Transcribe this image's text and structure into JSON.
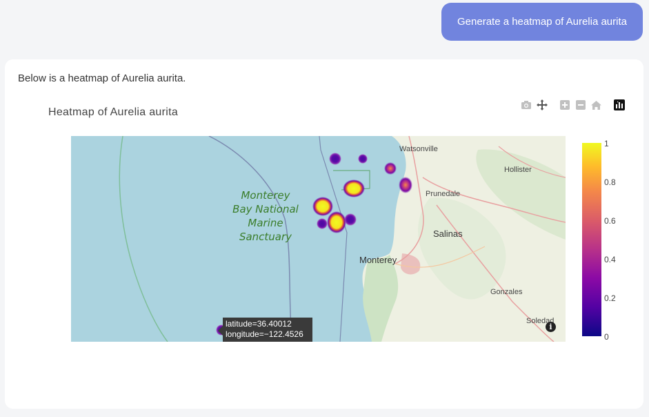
{
  "user_message": "Generate a heatmap of Aurelia aurita",
  "assistant": {
    "intro": "Below is a heatmap of Aurelia aurita."
  },
  "plot": {
    "title": "Heatmap of Aurelia aurita",
    "modebar": [
      "camera-icon",
      "pan-icon",
      "zoom-in-icon",
      "zoom-out-icon",
      "home-icon",
      "plotly-logo-icon"
    ],
    "map_labels": {
      "sanctuary": [
        "Monterey",
        "Bay National",
        "Marine",
        "Sanctuary"
      ],
      "watsonville": "Watsonville",
      "hollister": "Hollister",
      "prunedale": "Prunedale",
      "salinas": "Salinas",
      "monterey": "Monterey",
      "gonzales": "Gonzales",
      "soledad": "Soledad"
    },
    "tooltip": {
      "line1": "latitude=36.40012",
      "line2": "longitude=−122.4526"
    },
    "colorbar": {
      "ticks": [
        "1",
        "0.8",
        "0.6",
        "0.4",
        "0.2",
        "0"
      ],
      "colorscale": [
        "#0d0887",
        "#5302a3",
        "#8b0aa5",
        "#b83289",
        "#db5c68",
        "#f48849",
        "#febc2a",
        "#f0f921"
      ]
    },
    "colors": {
      "ocean": "#a9d3e0",
      "land": "#eef0e4",
      "sanctuary_text": "#3a7d2a"
    }
  }
}
